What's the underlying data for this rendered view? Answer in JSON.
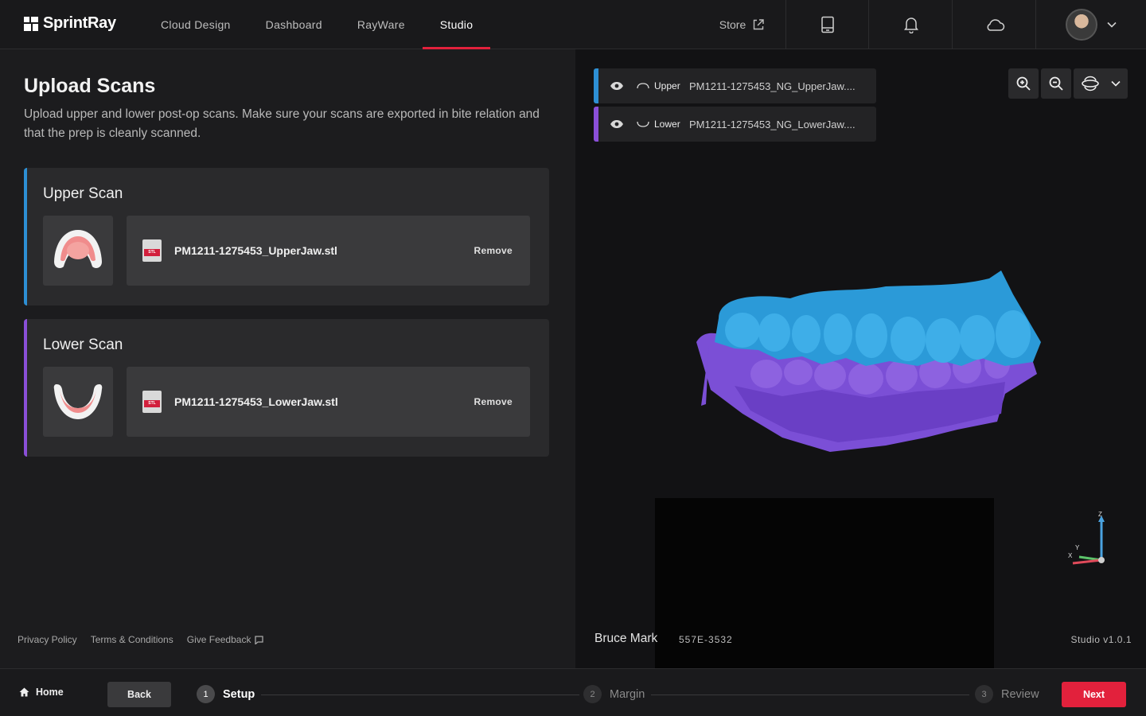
{
  "brand": {
    "name": "SprintRay"
  },
  "nav": {
    "items": [
      {
        "label": "Cloud Design"
      },
      {
        "label": "Dashboard"
      },
      {
        "label": "RayWare"
      },
      {
        "label": "Studio"
      }
    ],
    "active": "Studio",
    "store_label": "Store"
  },
  "page": {
    "title": "Upload Scans",
    "subtitle": "Upload upper and lower post-op scans. Make sure your scans are exported in bite relation and that the prep is cleanly scanned."
  },
  "scans": {
    "upper": {
      "title": "Upper Scan",
      "file": "PM1211-1275453_UpperJaw.stl",
      "remove_label": "Remove",
      "badge": "STL"
    },
    "lower": {
      "title": "Lower Scan",
      "file": "PM1211-1275453_LowerJaw.stl",
      "remove_label": "Remove",
      "badge": "STL"
    }
  },
  "footer": {
    "privacy": "Privacy Policy",
    "terms": "Terms & Conditions",
    "feedback": "Give Feedback"
  },
  "viewer": {
    "layers": [
      {
        "kind": "Upper",
        "file": "PM1211-1275453_NG_UpperJaw....",
        "color": "#2d8fd4"
      },
      {
        "kind": "Lower",
        "file": "PM1211-1275453_NG_LowerJaw....",
        "color": "#8a4fd8"
      }
    ],
    "patient_name": "Bruce Mark",
    "case_id": "557E-3532",
    "version": "Studio v1.0.1",
    "axes": {
      "z": "Z",
      "y": "Y",
      "x": "X"
    }
  },
  "bottom": {
    "home_label": "Home",
    "back_label": "Back",
    "steps": [
      {
        "num": "1",
        "label": "Setup",
        "state": "active"
      },
      {
        "num": "2",
        "label": "Margin",
        "state": "inactive"
      },
      {
        "num": "3",
        "label": "Review",
        "state": "inactive"
      }
    ],
    "next_label": "Next"
  },
  "colors": {
    "accent": "#e2213c",
    "upper": "#2d8fd4",
    "lower": "#8a4fd8",
    "upper_model": "#2b9ad8",
    "lower_model": "#7b4fd6"
  }
}
